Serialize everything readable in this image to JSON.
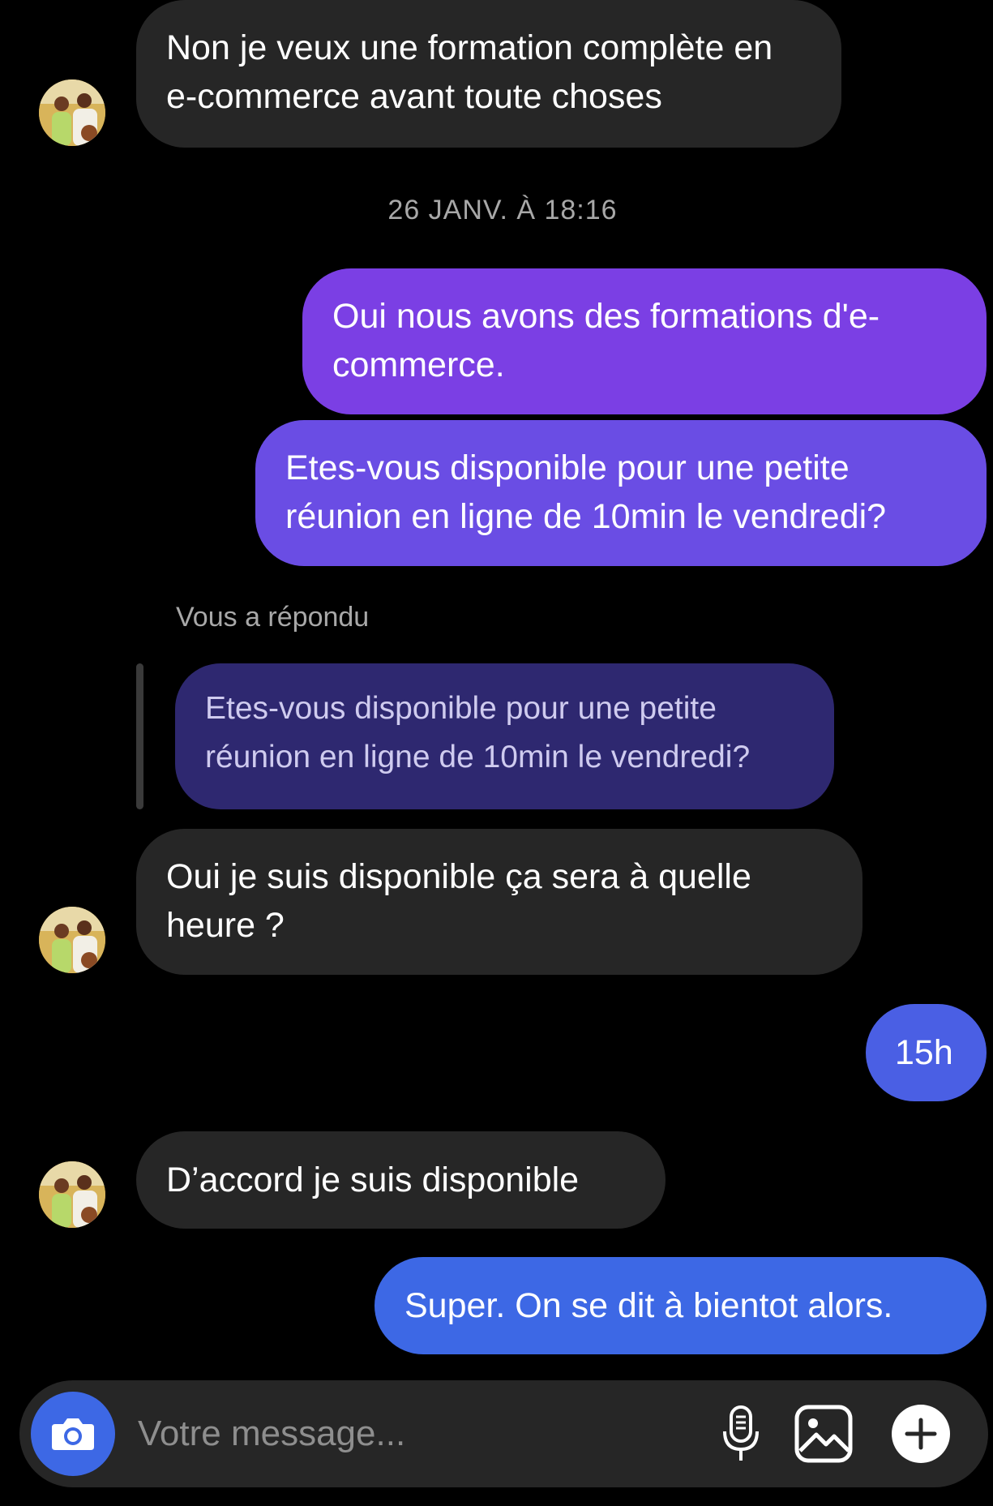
{
  "colors": {
    "background": "#000000",
    "incoming_bubble": "#262626",
    "outgoing_gradient_top": "#7b3fe4",
    "outgoing_gradient_bottom": "#3d68e5",
    "quoted_bubble": "#2e2870",
    "meta_text": "#a8a8a8"
  },
  "messages": [
    {
      "direction": "incoming",
      "text": "Non je veux une formation complète en e-commerce avant toute choses"
    },
    {
      "direction": "outgoing",
      "text": "Oui nous avons des formations d'e-commerce."
    },
    {
      "direction": "outgoing",
      "text": "Etes-vous disponible pour une petite réunion en ligne de 10min le vendredi?"
    },
    {
      "direction": "incoming",
      "text": "Oui je suis disponible ça sera à quelle heure ?"
    },
    {
      "direction": "outgoing",
      "text": "15h"
    },
    {
      "direction": "incoming",
      "text": "D’accord je suis disponible"
    },
    {
      "direction": "outgoing",
      "text": "Super. On se dit à bientot alors."
    }
  ],
  "timestamp": "26 JANV. À 18:16",
  "reply": {
    "label": "Vous a répondu",
    "quoted_text": "Etes-vous disponible pour une petite réunion en ligne de 10min le vendredi?"
  },
  "composer": {
    "placeholder": "Votre message...",
    "icons": [
      "camera-icon",
      "microphone-icon",
      "gallery-icon",
      "plus-icon"
    ]
  }
}
